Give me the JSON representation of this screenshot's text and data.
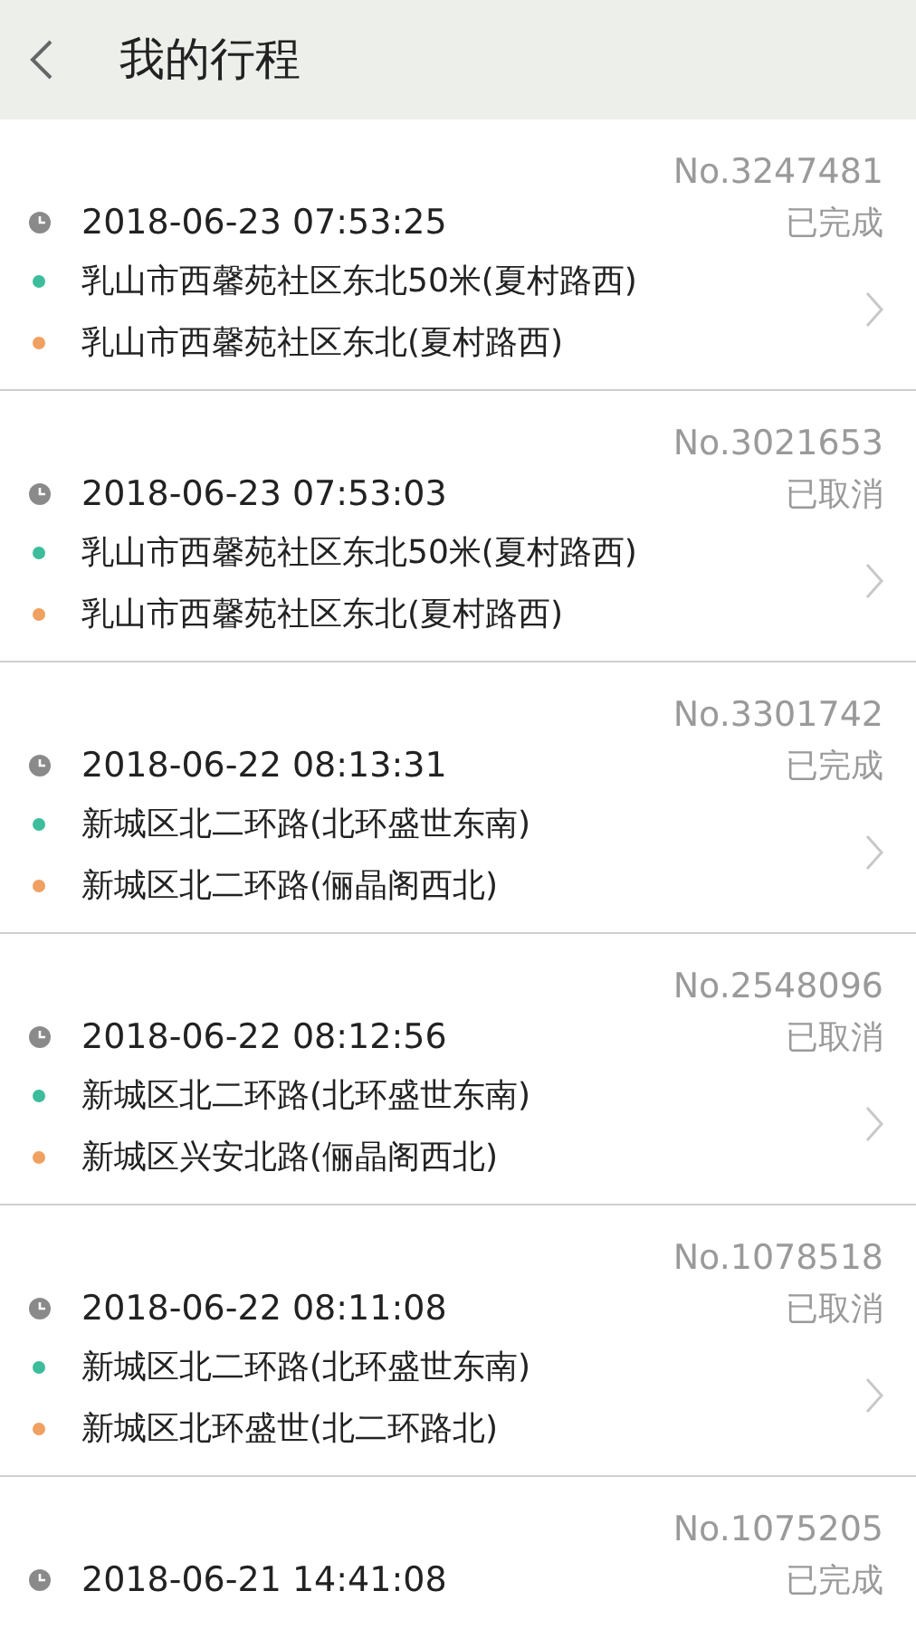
{
  "header": {
    "title": "我的行程"
  },
  "trips": [
    {
      "number": "No.3247481",
      "time": "2018-06-23 07:53:25",
      "status": "已完成",
      "start": "乳山市西馨苑社区东北50米(夏村路西)",
      "end": "乳山市西馨苑社区东北(夏村路西)"
    },
    {
      "number": "No.3021653",
      "time": "2018-06-23 07:53:03",
      "status": "已取消",
      "start": "乳山市西馨苑社区东北50米(夏村路西)",
      "end": "乳山市西馨苑社区东北(夏村路西)"
    },
    {
      "number": "No.3301742",
      "time": "2018-06-22 08:13:31",
      "status": "已完成",
      "start": "新城区北二环路(北环盛世东南)",
      "end": "新城区北二环路(俪晶阁西北)"
    },
    {
      "number": "No.2548096",
      "time": "2018-06-22 08:12:56",
      "status": "已取消",
      "start": "新城区北二环路(北环盛世东南)",
      "end": "新城区兴安北路(俪晶阁西北)"
    },
    {
      "number": "No.1078518",
      "time": "2018-06-22 08:11:08",
      "status": "已取消",
      "start": "新城区北二环路(北环盛世东南)",
      "end": "新城区北环盛世(北二环路北)"
    },
    {
      "number": "No.1075205",
      "time": "2018-06-21 14:41:08",
      "status": "已完成"
    }
  ]
}
